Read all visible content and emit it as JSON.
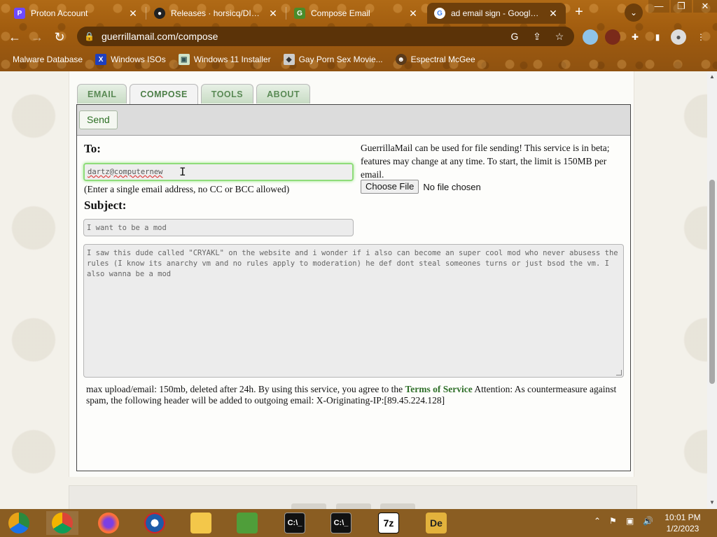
{
  "browser": {
    "tabs": [
      {
        "label": "Proton Account",
        "favicon": "proton-icon"
      },
      {
        "label": "Releases · horsicq/DIE-en",
        "favicon": "github-icon"
      },
      {
        "label": "Compose Email",
        "favicon": "guerrilla-icon"
      },
      {
        "label": "ad email sign - Google Sea",
        "favicon": "google-icon"
      }
    ],
    "new_tab_label": "+",
    "tab_search_label": "⌄",
    "url": "guerrillamail.com/compose",
    "bookmarks": [
      {
        "label": "Malware Database",
        "icon": "malware-db-icon"
      },
      {
        "label": "Windows ISOs",
        "icon": "x-icon"
      },
      {
        "label": "Windows 11 Installer",
        "icon": "image-icon"
      },
      {
        "label": "Gay Porn Sex Movie...",
        "icon": "site-icon"
      },
      {
        "label": "Espectral McGee",
        "icon": "avatar-icon"
      }
    ]
  },
  "site": {
    "nav_tabs": [
      {
        "label": "EMAIL"
      },
      {
        "label": "COMPOSE"
      },
      {
        "label": "TOOLS"
      },
      {
        "label": "ABOUT"
      }
    ],
    "active_tab": "COMPOSE",
    "send_label": "Send",
    "to_label": "To:",
    "to_value": "dartz@computernew",
    "to_hint": "(Enter a single email address, no CC or BCC allowed)",
    "subject_label": "Subject:",
    "subject_value": "I want to be a mod",
    "file_info": "GuerrillaMail can be used for file sending! This service is in beta; features may change at any time. To start, the limit is 150MB per email.",
    "choose_file_label": "Choose File",
    "file_status": "No file chosen",
    "body_value": "I saw this dude called \"CRYAKL\" on the website and i wonder if i also can become an super cool mod who never abusess the rules (I know its anarchy vm and no rules apply to moderation) he def dont steal someones turns or just bsod the vm. I also wanna be a mod",
    "footer_pre": "max upload/email: 150mb, deleted after 24h. By using this service, you agree to the",
    "footer_tos": "Terms of Service",
    "footer_post": "Attention: As countermeasure against spam, the following header will be added to outgoing email: X-Originating-IP:[89.45.224.128]"
  },
  "taskbar": {
    "apps": [
      "chrome-canary-icon",
      "chrome-icon",
      "firefox-icon",
      "obama-icon",
      "file-explorer-icon",
      "network-app-icon",
      "terminal-icon",
      "terminal-icon",
      "7zip-icon",
      "die-icon"
    ],
    "terminal_label": "C:\\_",
    "sevenzip_label": "7z",
    "die_label": "De",
    "time": "10:01 PM",
    "date": "1/2/2023"
  },
  "colors": {
    "chrome_bg": "#a25d0f",
    "accent_green": "#2f6f29",
    "focus_green": "#8fdc7a",
    "taskbar_bg": "#8a5d22"
  }
}
